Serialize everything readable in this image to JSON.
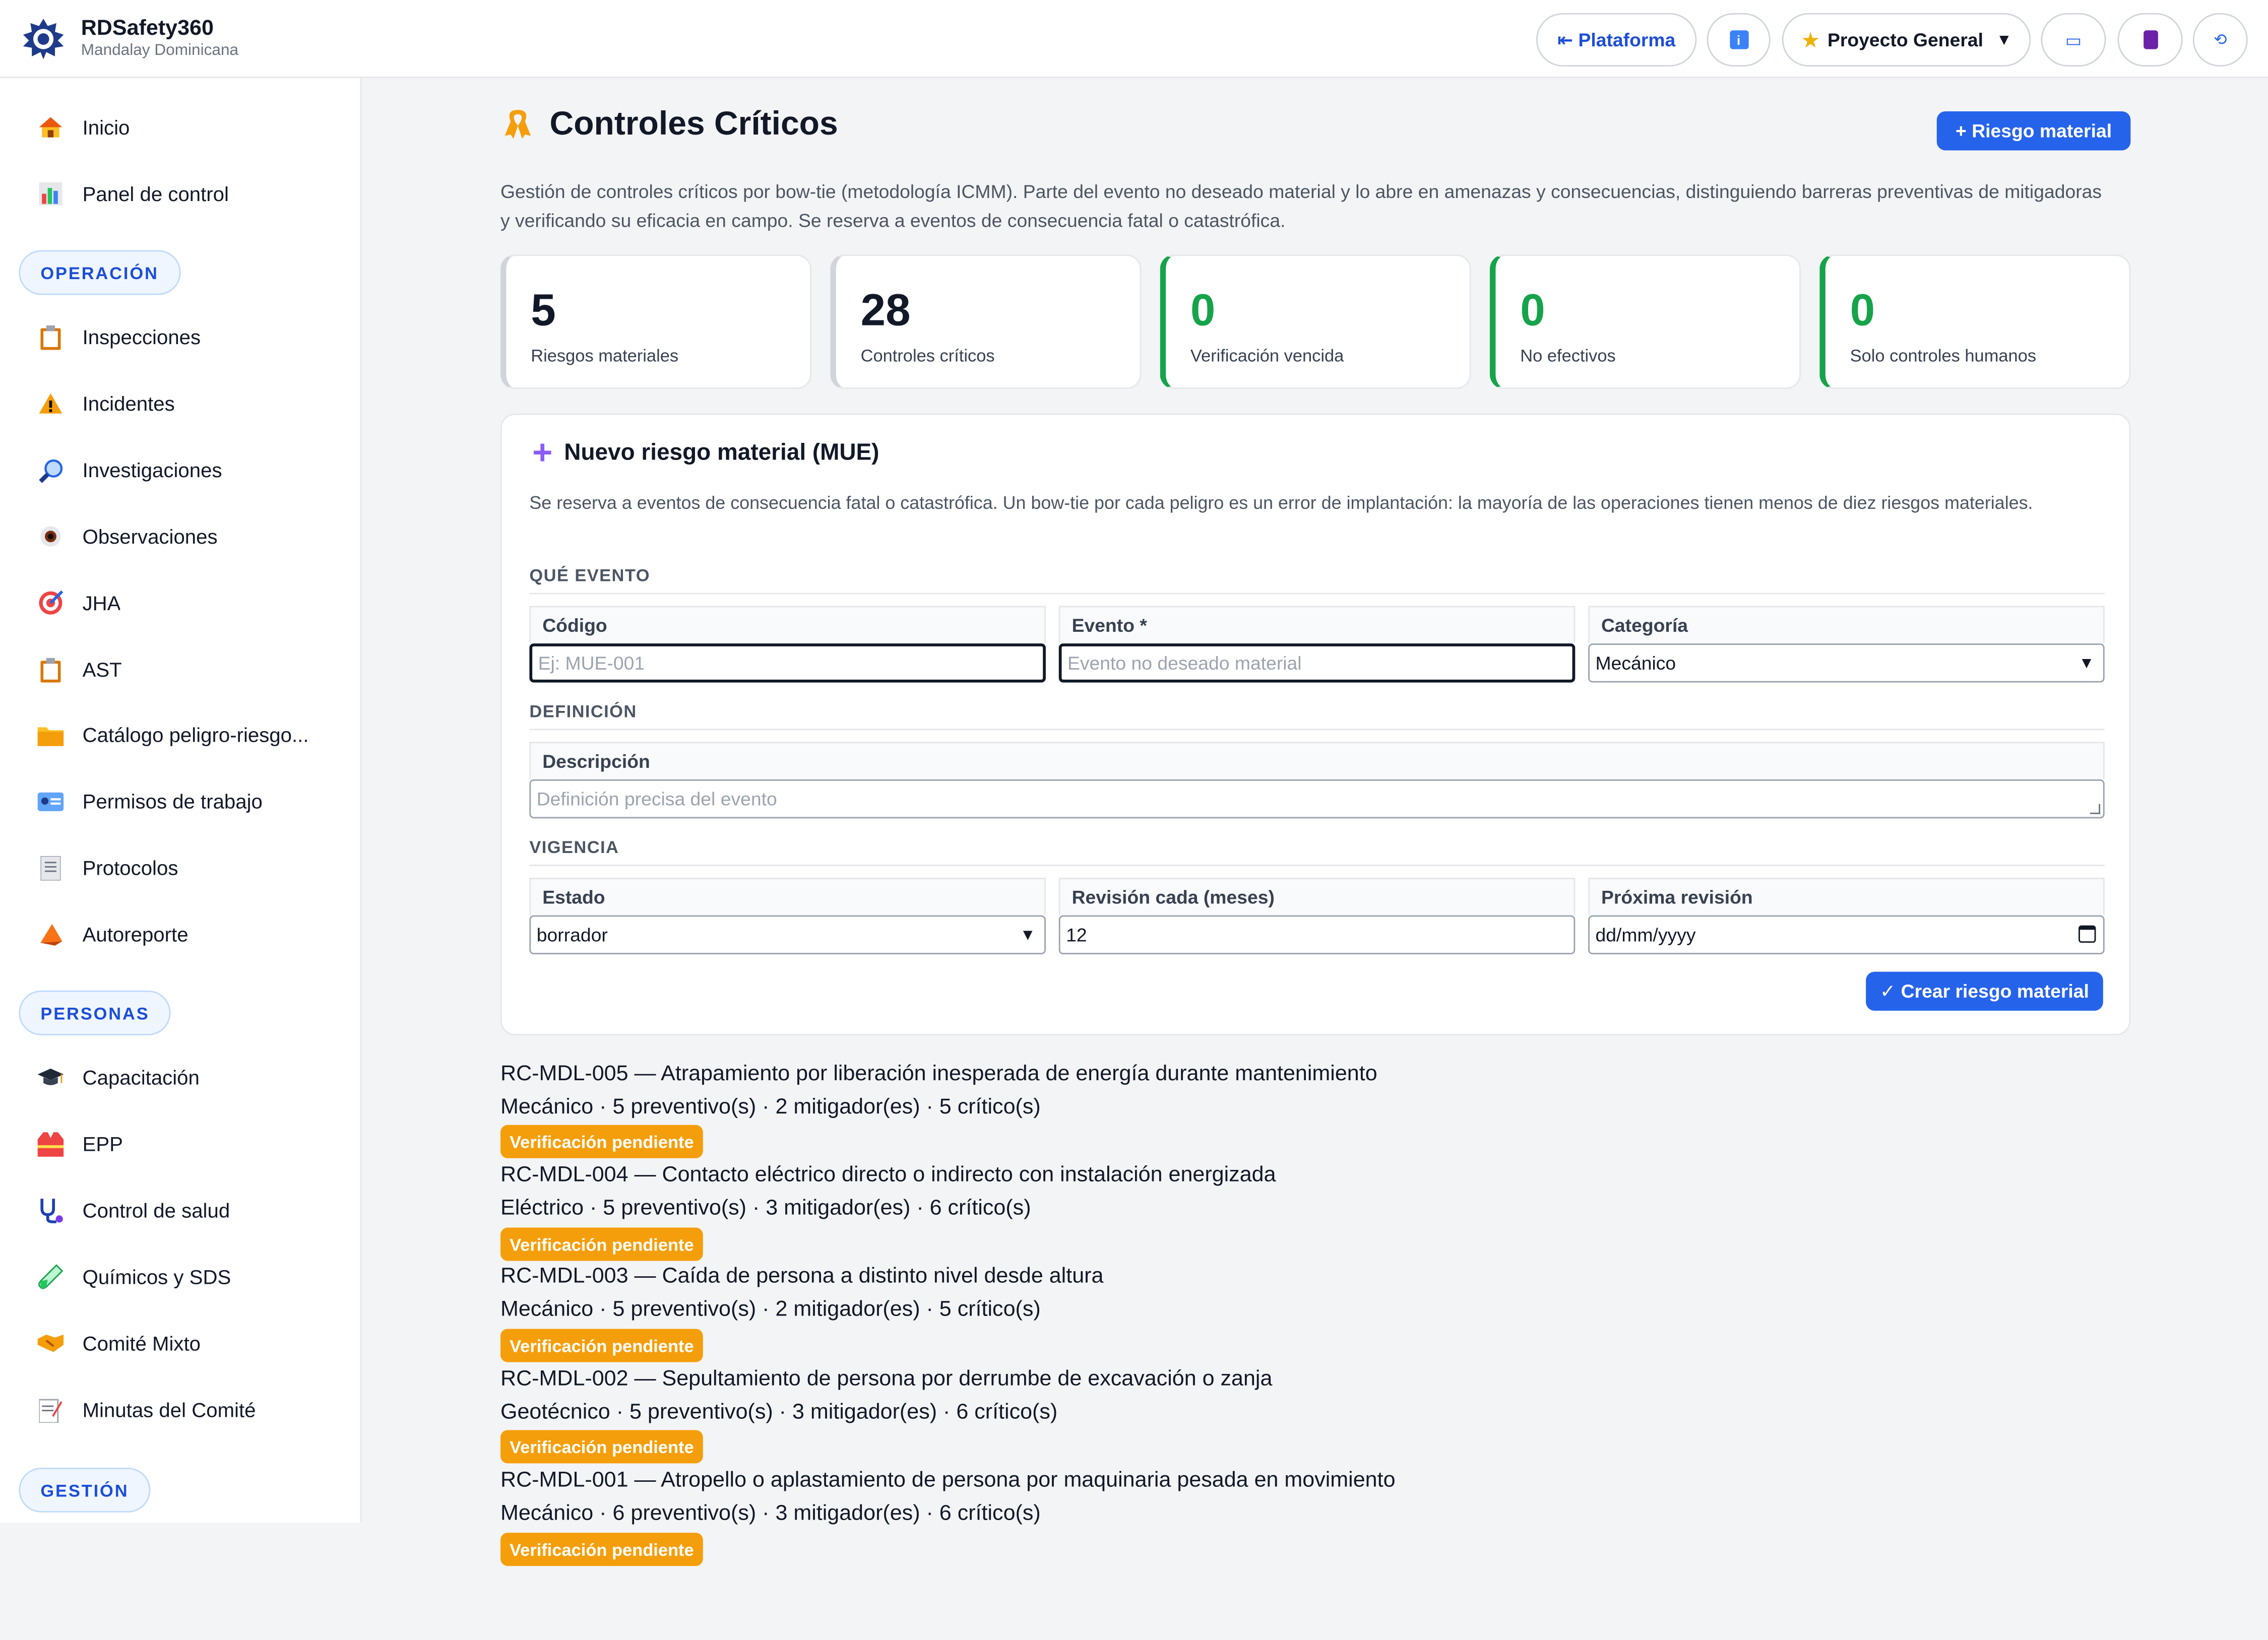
{
  "brand": {
    "name": "RDSafety360",
    "subtitle": "Mandalay Dominicana"
  },
  "header": {
    "platform_label": "⇤ Plataforma",
    "project_label": "Proyecto General",
    "info_icon": "info-icon",
    "icons": [
      "book-icon",
      "calculator-icon",
      "sync-icon"
    ]
  },
  "sidebar": {
    "top": [
      {
        "label": "Inicio",
        "icon": "home-icon"
      },
      {
        "label": "Panel de control",
        "icon": "bar-chart-icon"
      }
    ],
    "sections": {
      "operacion": "OPERACIÓN",
      "personas": "PERSONAS",
      "gestion": "GESTIÓN"
    },
    "operacion_items": [
      {
        "label": "Inspecciones",
        "icon": "clipboard-icon"
      },
      {
        "label": "Incidentes",
        "icon": "warning-icon"
      },
      {
        "label": "Investigaciones",
        "icon": "magnifier-icon"
      },
      {
        "label": "Observaciones",
        "icon": "eye-icon"
      },
      {
        "label": "JHA",
        "icon": "target-icon"
      },
      {
        "label": "AST",
        "icon": "clipboard-icon"
      },
      {
        "label": "Catálogo peligro-riesgo...",
        "icon": "folder-icon"
      },
      {
        "label": "Permisos de trabajo",
        "icon": "id-card-icon"
      },
      {
        "label": "Protocolos",
        "icon": "document-icon"
      },
      {
        "label": "Autoreporte",
        "icon": "megaphone-icon"
      }
    ],
    "personas_items": [
      {
        "label": "Capacitación",
        "icon": "graduation-cap-icon"
      },
      {
        "label": "EPP",
        "icon": "safety-vest-icon"
      },
      {
        "label": "Control de salud",
        "icon": "stethoscope-icon"
      },
      {
        "label": "Químicos y SDS",
        "icon": "test-tube-icon"
      },
      {
        "label": "Comité Mixto",
        "icon": "handshake-icon"
      },
      {
        "label": "Minutas del Comité",
        "icon": "memo-icon"
      }
    ]
  },
  "page": {
    "title": "Controles Críticos",
    "add_button": "+ Riesgo material",
    "intro": "Gestión de controles críticos por bow-tie (metodología ICMM). Parte del evento no deseado material y lo abre en amenazas y consecuencias, distinguiendo barreras preventivas de mitigadoras y verificando su eficacia en campo. Se reserva a eventos de consecuencia fatal o catastrófica."
  },
  "kpis": [
    {
      "value": "5",
      "label": "Riesgos materiales"
    },
    {
      "value": "28",
      "label": "Controles críticos"
    },
    {
      "value": "0",
      "label": "Verificación vencida"
    },
    {
      "value": "0",
      "label": "No efectivos"
    },
    {
      "value": "0",
      "label": "Solo controles humanos"
    }
  ],
  "form": {
    "title": "Nuevo riesgo material (MUE)",
    "description": "Se reserva a eventos de consecuencia fatal o catastrófica. Un bow-tie por cada peligro es un error de implantación: la mayoría de las operaciones tienen menos de diez riesgos materiales.",
    "section_event": "QUÉ EVENTO",
    "section_definition": "DEFINICIÓN",
    "section_validity": "VIGENCIA",
    "codigo": {
      "label": "Código",
      "placeholder": "Ej: MUE-001"
    },
    "evento": {
      "label": "Evento *",
      "placeholder": "Evento no deseado material"
    },
    "categoria": {
      "label": "Categoría",
      "value": "Mecánico"
    },
    "descripcion": {
      "label": "Descripción",
      "placeholder": "Definición precisa del evento"
    },
    "estado": {
      "label": "Estado",
      "value": "borrador"
    },
    "revision": {
      "label": "Revisión cada (meses)",
      "value": "12"
    },
    "proxima": {
      "label": "Próxima revisión",
      "value": "dd/mm/yyyy"
    },
    "submit": "✓ Crear riesgo material"
  },
  "risks": [
    {
      "title": "RC-MDL-005 — Atrapamiento por liberación inesperada de energía durante mantenimiento",
      "meta": "Mecánico · 5 preventivo(s) · 2 mitigador(es) · 5 crítico(s)",
      "status": "Verificación pendiente"
    },
    {
      "title": "RC-MDL-004 — Contacto eléctrico directo o indirecto con instalación energizada",
      "meta": "Eléctrico · 5 preventivo(s) · 3 mitigador(es) · 6 crítico(s)",
      "status": "Verificación pendiente"
    },
    {
      "title": "RC-MDL-003 — Caída de persona a distinto nivel desde altura",
      "meta": "Mecánico · 5 preventivo(s) · 2 mitigador(es) · 5 crítico(s)",
      "status": "Verificación pendiente"
    },
    {
      "title": "RC-MDL-002 — Sepultamiento de persona por derrumbe de excavación o zanja",
      "meta": "Geotécnico · 5 preventivo(s) · 3 mitigador(es) · 6 crítico(s)",
      "status": "Verificación pendiente"
    },
    {
      "title": "RC-MDL-001 — Atropello o aplastamiento de persona por maquinaria pesada en movimiento",
      "meta": "Mecánico · 6 preventivo(s) · 3 mitigador(es) · 6 crítico(s)",
      "status": "Verificación pendiente"
    }
  ],
  "colors": {
    "accent": "#2563eb",
    "success": "#16a34a",
    "warning": "#f59e0b"
  }
}
